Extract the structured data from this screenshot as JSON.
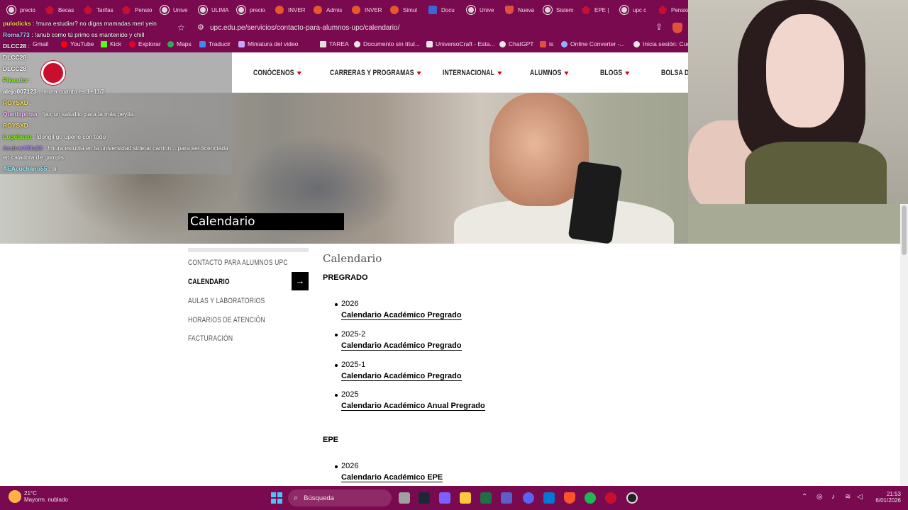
{
  "tabs": [
    {
      "label": "precio",
      "icon": "chrome-icon"
    },
    {
      "label": "Becas",
      "icon": "upc-icon"
    },
    {
      "label": "Tarifas",
      "icon": "upc-icon"
    },
    {
      "label": "Pensio",
      "icon": "upc-icon"
    },
    {
      "label": "Unive",
      "icon": "globe-icon"
    },
    {
      "label": "ULIMA",
      "icon": "chrome-icon"
    },
    {
      "label": "precio",
      "icon": "chrome-icon"
    },
    {
      "label": "INVER",
      "icon": "gear-icon"
    },
    {
      "label": "Admis",
      "icon": "gear-icon"
    },
    {
      "label": "INVER",
      "icon": "gear-icon"
    },
    {
      "label": "Simul",
      "icon": "gear-icon"
    },
    {
      "label": "Docu",
      "icon": "doc-icon"
    },
    {
      "label": "Unive",
      "icon": "globe-icon"
    },
    {
      "label": "Nueva",
      "icon": "brave-icon"
    },
    {
      "label": "Sistem",
      "icon": "person-icon"
    },
    {
      "label": "EPE |",
      "icon": "upc-icon"
    },
    {
      "label": "upc c",
      "icon": "chrome-icon"
    },
    {
      "label": "Pensio",
      "icon": "upc-icon"
    }
  ],
  "address": {
    "url": "upc.edu.pe/servicios/contacto-para-alumnos-upc/calendario/"
  },
  "bookmarks": [
    {
      "label": "Miniatura del video"
    },
    {
      "label": "TAREA"
    },
    {
      "label": "Documento sin títul..."
    },
    {
      "label": "UniversoCraft - Esta..."
    },
    {
      "label": "ChatGPT"
    },
    {
      "label": "is"
    },
    {
      "label": "Online Converter -..."
    },
    {
      "label": "Inicia sesión: Cuen"
    }
  ],
  "bookmarks_left": [
    "Gmail",
    "YouTube",
    "Kick",
    "Explorar",
    "Maps",
    "Traducir"
  ],
  "chat": [
    {
      "user": "pulodicks",
      "text": ": !mura estudiar? no digas mamadas meri yein",
      "color": "#ffd54a"
    },
    {
      "user": "Roma773",
      "text": ": !anub como tú primo es mantenido y chill",
      "color": "#9ecbff"
    },
    {
      "user": "DLCC28",
      "text": ":",
      "color": "#ffffff"
    },
    {
      "user": "DLCC28",
      "text": "",
      "color": "#ffffff"
    },
    {
      "user": "DLCC28",
      "text": "",
      "color": "#ffffff"
    },
    {
      "user": "Pikeador",
      "text": ":",
      "color": "#7cfc00"
    },
    {
      "user": "alejo007123",
      "text": ": !mura  cuanto es 1+11/2",
      "color": "#ffffff"
    },
    {
      "user": "ROYSXD",
      "text": ":",
      "color": "#ffe45c"
    },
    {
      "user": "Quetiapinaa",
      "text": ": !jax un saludito para la más peyita",
      "color": "#ffb4ff"
    },
    {
      "user": "ROYSXD",
      "text": ":",
      "color": "#ffe45c"
    },
    {
      "user": "Lugebaso",
      "text": ": !dongil go upene  con todo",
      "color": "#7cfc00"
    },
    {
      "user": "AndresVilla26",
      "text": ": !mura estudia en la universidad sideral carrion... para ser licenciada",
      "color": "#b27cff"
    },
    {
      "user": "",
      "text": "en caladora de gampis",
      "color": "#ffffff"
    },
    {
      "user": "AEAcuchano55",
      "text": ": si",
      "color": "#9ff3ff"
    }
  ],
  "nav": {
    "items": [
      "CONÓCENOS",
      "CARRERAS Y PROGRAMAS",
      "INTERNACIONAL",
      "ALUMNOS",
      "BLOGS",
      "BOLSA DE"
    ]
  },
  "hero": {
    "title": "Calendario"
  },
  "sidebar": {
    "items": [
      {
        "label": "CONTACTO PARA ALUMNOS UPC",
        "active": false
      },
      {
        "label": "CALENDARIO",
        "active": true
      },
      {
        "label": "AULAS Y LABORATORIOS",
        "active": false
      },
      {
        "label": "HORARIOS DE ATENCIÓN",
        "active": false
      },
      {
        "label": "FACTURACIÓN",
        "active": false
      }
    ],
    "arrow": "→"
  },
  "content": {
    "title": "Calendario",
    "sections": [
      {
        "heading": "PREGRADO",
        "items": [
          {
            "year": "2026",
            "link": "Calendario Académico Pregrado"
          },
          {
            "year": "2025-2",
            "link": "Calendario Académico Pregrado"
          },
          {
            "year": "2025-1",
            "link": "Calendario Académico Pregrado"
          },
          {
            "year": "2025",
            "link": "Calendario Académico Anual Pregrado"
          }
        ]
      },
      {
        "heading": "EPE",
        "items": [
          {
            "year": "2026",
            "link": "Calendario Académico EPE"
          }
        ]
      }
    ]
  },
  "taskbar": {
    "temperature": "21°C",
    "weather": "Mayorm. nublado",
    "search": "Búsqueda",
    "time": "21:53",
    "date": "6/01/2026"
  }
}
